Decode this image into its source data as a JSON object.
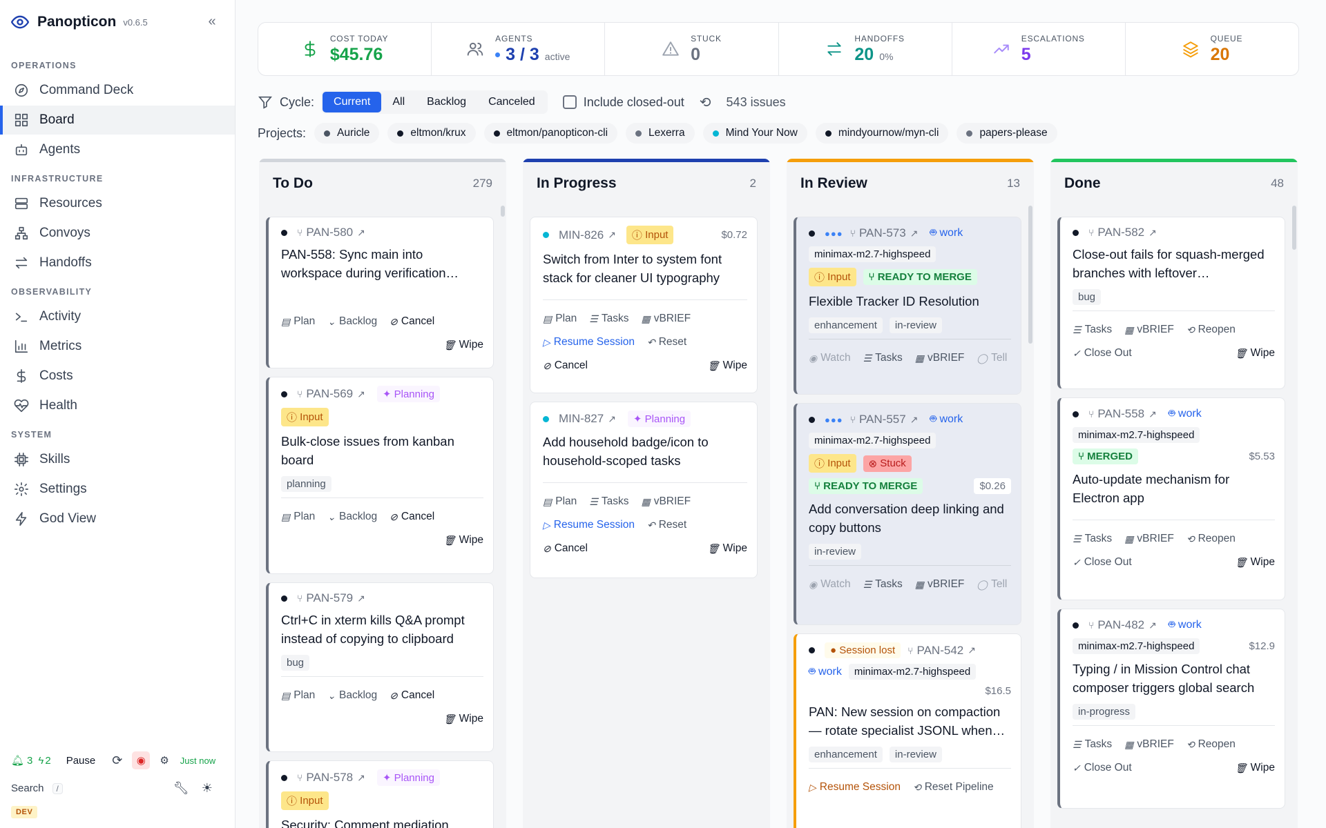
{
  "app": {
    "name": "Panopticon",
    "version": "v0.6.5"
  },
  "nav": {
    "sections": [
      {
        "title": "OPERATIONS",
        "items": [
          "Command Deck",
          "Board",
          "Agents"
        ]
      },
      {
        "title": "INFRASTRUCTURE",
        "items": [
          "Resources",
          "Convoys",
          "Handoffs"
        ]
      },
      {
        "title": "OBSERVABILITY",
        "items": [
          "Activity",
          "Metrics",
          "Costs",
          "Health"
        ]
      },
      {
        "title": "SYSTEM",
        "items": [
          "Skills",
          "Settings",
          "God View"
        ]
      }
    ],
    "active": "Board"
  },
  "footer": {
    "notif_count": "3",
    "bolt_count": "2",
    "pause": "Pause",
    "updated": "Just now",
    "search": "Search",
    "search_key": "/",
    "env": "DEV"
  },
  "stats": [
    {
      "label": "COST TODAY",
      "value": "$45.76",
      "sub": "",
      "color": "#16a34a",
      "icon": "dollar-icon"
    },
    {
      "label": "AGENTS",
      "value": "3 / 3",
      "sub": "active",
      "color": "#1e40af",
      "icon": "users-icon"
    },
    {
      "label": "STUCK",
      "value": "0",
      "sub": "",
      "color": "#6b7280",
      "icon": "warning-icon"
    },
    {
      "label": "HANDOFFS",
      "value": "20",
      "sub": "0%",
      "color": "#0d9488",
      "icon": "swap-icon"
    },
    {
      "label": "ESCALATIONS",
      "value": "5",
      "sub": "",
      "color": "#7c3aed",
      "icon": "trend-icon"
    },
    {
      "label": "QUEUE",
      "value": "20",
      "sub": "",
      "color": "#d97706",
      "icon": "layers-icon"
    }
  ],
  "filters": {
    "cycle_label": "Cycle:",
    "cycles": [
      "Current",
      "All",
      "Backlog",
      "Canceled"
    ],
    "selected_cycle": "Current",
    "include_closed": "Include closed-out",
    "issue_count": "543 issues"
  },
  "projects": {
    "label": "Projects:",
    "items": [
      {
        "name": "Auricle",
        "color": "#374151"
      },
      {
        "name": "eltmon/krux",
        "color": "#111827"
      },
      {
        "name": "eltmon/panopticon-cli",
        "color": "#111827"
      },
      {
        "name": "Lexerra",
        "color": "#6b7280"
      },
      {
        "name": "Mind Your Now",
        "color": "#06b6d4"
      },
      {
        "name": "mindyournow/myn-cli",
        "color": "#111827"
      },
      {
        "name": "papers-please",
        "color": "#6b7280"
      }
    ]
  },
  "columns": [
    {
      "title": "To Do",
      "count": "279",
      "color": "#d1d5db",
      "cards": [
        {
          "id": "PAN-580",
          "title": "PAN-558: Sync main into workspace during verification…",
          "labels": [],
          "actions": [
            "Plan",
            "Backlog",
            "Cancel",
            "Wipe"
          ]
        },
        {
          "id": "PAN-569",
          "badge": "Planning",
          "input": "Input",
          "title": "Bulk-close issues from kanban board",
          "labels": [
            "planning"
          ],
          "actions": [
            "Plan",
            "Backlog",
            "Cancel",
            "Wipe"
          ]
        },
        {
          "id": "PAN-579",
          "title": "Ctrl+C in xterm kills Q&A prompt instead of copying to clipboard",
          "labels": [
            "bug"
          ],
          "actions": [
            "Plan",
            "Backlog",
            "Cancel",
            "Wipe"
          ]
        },
        {
          "id": "PAN-578",
          "badge": "Planning",
          "input": "Input",
          "title": "Security: Comment mediation",
          "labels": [],
          "actions": []
        }
      ]
    },
    {
      "title": "In Progress",
      "count": "2",
      "color": "#1e40af",
      "cards": [
        {
          "id": "MIN-826",
          "input": "Input",
          "cost": "$0.72",
          "title": "Switch from Inter to system font stack for cleaner UI typography",
          "actions": [
            "Plan",
            "Tasks",
            "vBRIEF",
            "Resume Session",
            "Reset",
            "Cancel",
            "Wipe"
          ]
        },
        {
          "id": "MIN-827",
          "badge": "Planning",
          "title": "Add household badge/icon to household-scoped tasks",
          "actions": [
            "Plan",
            "Tasks",
            "vBRIEF",
            "Resume Session",
            "Reset",
            "Cancel",
            "Wipe"
          ]
        }
      ]
    },
    {
      "title": "In Review",
      "count": "13",
      "color": "#f59e0b",
      "cards": [
        {
          "id": "PAN-573",
          "work": "work",
          "model": "minimax-m2.7-highspeed",
          "input": "Input",
          "status": "READY TO MERGE",
          "title": "Flexible Tracker ID Resolution",
          "labels": [
            "enhancement",
            "in-review"
          ],
          "actions": [
            "Watch",
            "Tasks",
            "vBRIEF",
            "Tell"
          ]
        },
        {
          "id": "PAN-557",
          "work": "work",
          "model": "minimax-m2.7-highspeed",
          "input": "Input",
          "stuck": "Stuck",
          "status": "READY TO MERGE",
          "cost": "$0.26",
          "title": "Add conversation deep linking and copy buttons",
          "labels": [
            "in-review"
          ],
          "actions": [
            "Watch",
            "Tasks",
            "vBRIEF",
            "Tell"
          ]
        },
        {
          "id": "PAN-542",
          "lost": "Session lost",
          "work": "work",
          "model": "minimax-m2.7-highspeed",
          "cost": "$16.5",
          "title": "PAN: New session on compaction — rotate specialist JSONL when…",
          "labels": [
            "enhancement",
            "in-review"
          ],
          "actions": [
            "Resume Session",
            "Reset Pipeline"
          ]
        }
      ]
    },
    {
      "title": "Done",
      "count": "48",
      "color": "#22c55e",
      "cards": [
        {
          "id": "PAN-582",
          "title": "Close-out fails for squash-merged branches with leftover…",
          "labels": [
            "bug"
          ],
          "actions": [
            "Tasks",
            "vBRIEF",
            "Reopen",
            "Close Out",
            "Wipe"
          ]
        },
        {
          "id": "PAN-558",
          "work": "work",
          "model": "minimax-m2.7-highspeed",
          "status": "MERGED",
          "cost": "$5.53",
          "title": "Auto-update mechanism for Electron app",
          "labels": [],
          "actions": [
            "Tasks",
            "vBRIEF",
            "Reopen",
            "Close Out",
            "Wipe"
          ]
        },
        {
          "id": "PAN-482",
          "work": "work",
          "model": "minimax-m2.7-highspeed",
          "cost": "$12.9",
          "title": "Typing / in Mission Control chat composer triggers global search",
          "labels": [
            "in-progress"
          ],
          "actions": [
            "Tasks",
            "vBRIEF",
            "Reopen",
            "Close Out",
            "Wipe"
          ]
        }
      ]
    }
  ]
}
